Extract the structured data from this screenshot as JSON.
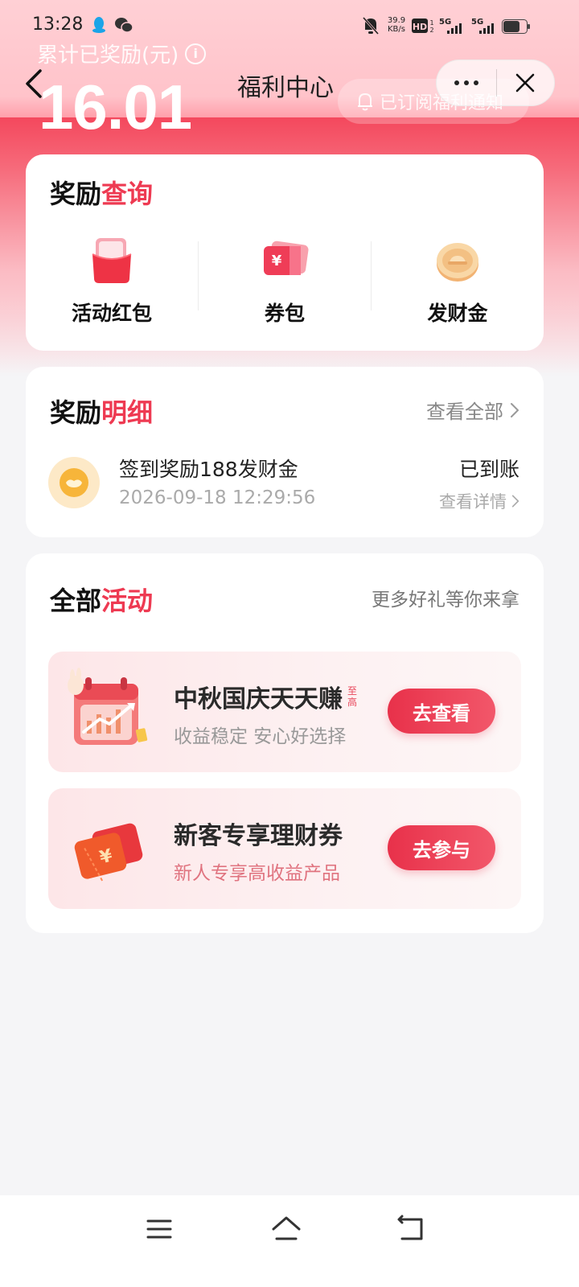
{
  "status_bar": {
    "time": "13:28",
    "net_speed_value": "39.9",
    "net_speed_unit": "KB/s",
    "hd_label": "HD",
    "network_1": "5G",
    "network_2": "5G"
  },
  "header": {
    "reward_label": "累计已奖励(元)",
    "info_symbol": "i",
    "reward_total": "16.01",
    "title": "福利中心",
    "subscribe_text": "已订阅福利通知"
  },
  "reward_query": {
    "title_main": "奖励",
    "title_accent": "查询",
    "items": [
      {
        "label": "活动红包",
        "icon": "red-packet-icon"
      },
      {
        "label": "券包",
        "icon": "coupon-icon"
      },
      {
        "label": "发财金",
        "icon": "gold-coin-icon"
      }
    ]
  },
  "reward_detail": {
    "title_main": "奖励",
    "title_accent": "明细",
    "view_all": "查看全部",
    "record": {
      "title": "签到奖励188发财金",
      "time": "2026-09-18 12:29:56",
      "status": "已到账",
      "detail_link": "查看详情"
    }
  },
  "activities": {
    "title_main": "全部",
    "title_accent": "活动",
    "more_text": "更多好礼等你来拿",
    "items": [
      {
        "title": "中秋国庆天天赚",
        "badge": "至高",
        "subtitle": "收益稳定 安心好选择",
        "button": "去查看",
        "icon": "calendar-growth-icon"
      },
      {
        "title": "新客专享理财券",
        "subtitle": "新人专享高收益产品",
        "button": "去参与",
        "icon": "red-envelope-coupon-icon"
      }
    ]
  },
  "colors": {
    "accent": "#ee3a52",
    "header_pink": "#f4485d",
    "button_gradient_start": "#e8314a",
    "button_gradient_end": "#f2576a"
  }
}
